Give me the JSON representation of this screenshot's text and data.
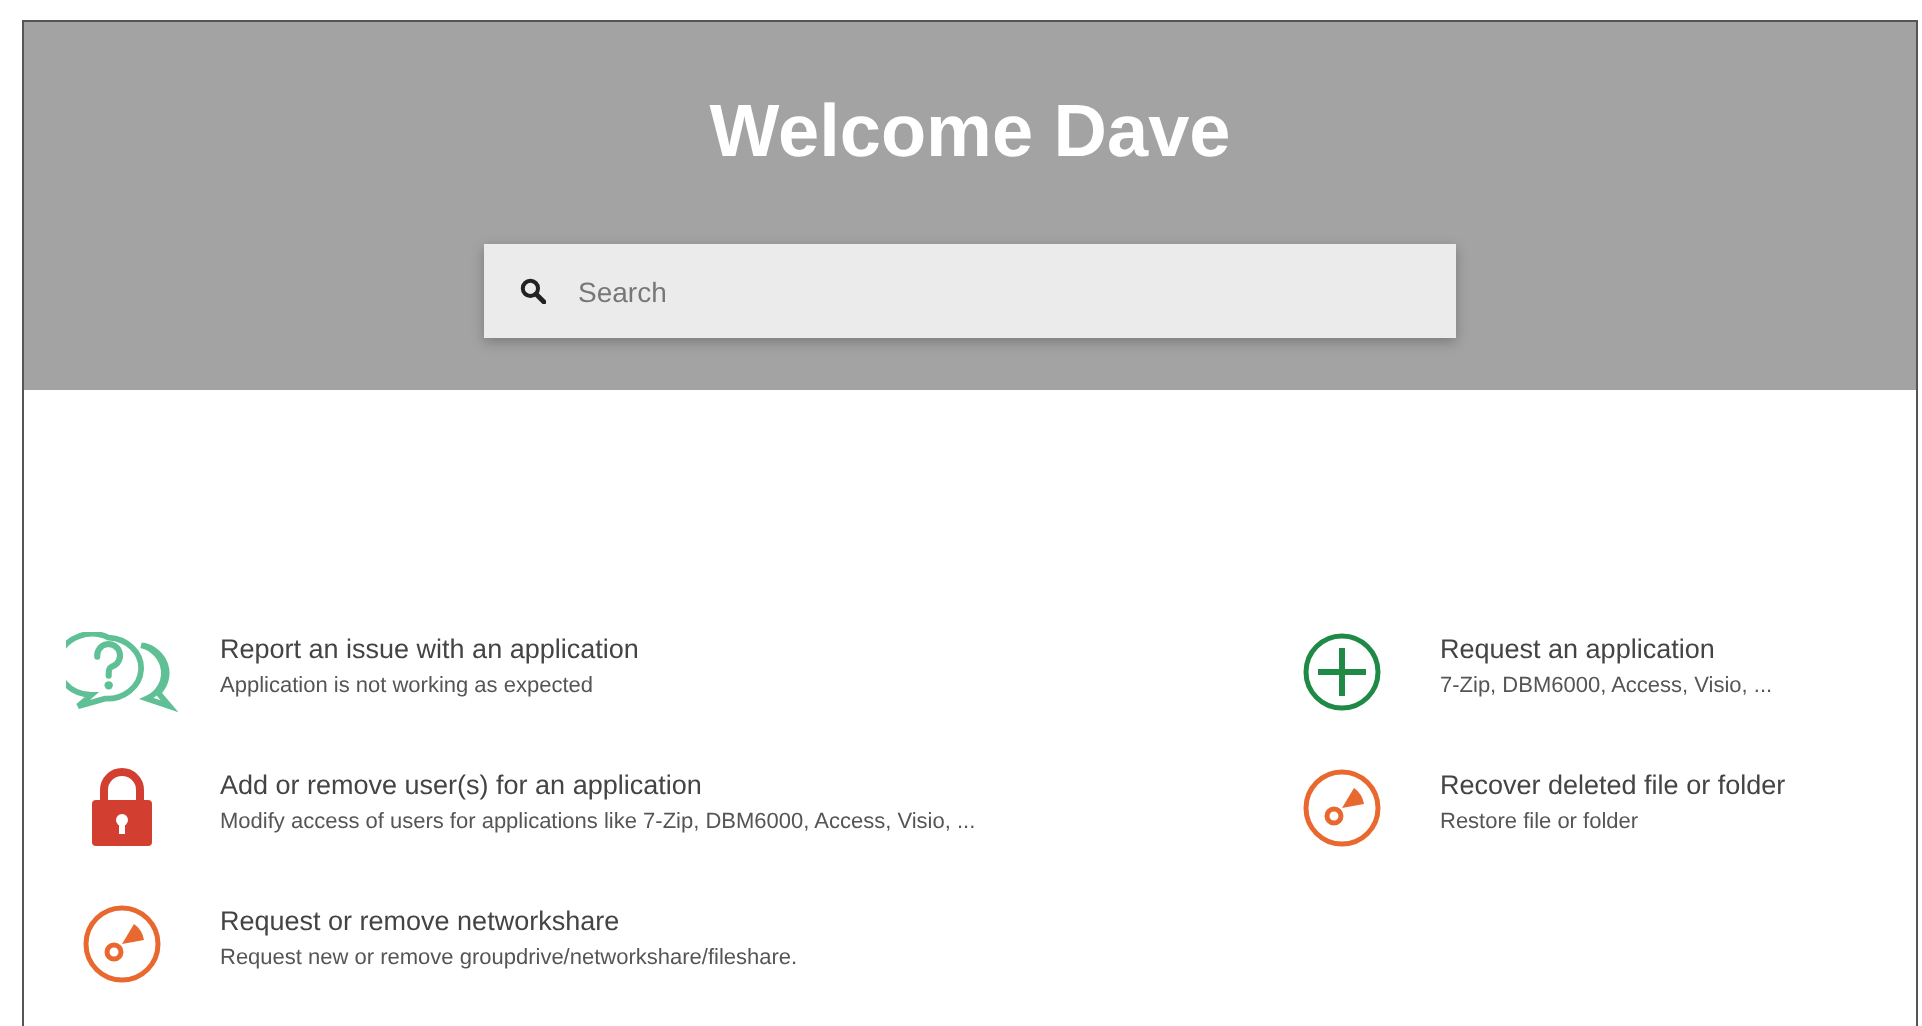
{
  "header": {
    "title": "Welcome Dave"
  },
  "search": {
    "placeholder": "Search"
  },
  "left_services": [
    {
      "title": "Report an issue with an application",
      "description": "Application is not working as expected",
      "kind": "question"
    },
    {
      "title": "Add or remove user(s) for an application",
      "description": "Modify access of users for applications like 7-Zip, DBM6000, Access, Visio, ...",
      "kind": "lock"
    },
    {
      "title": "Request or remove networkshare",
      "description": "Request new or remove groupdrive/networkshare/fileshare.",
      "kind": "disc"
    }
  ],
  "right_services": [
    {
      "title": "Request an application",
      "description": "7-Zip, DBM6000, Access, Visio, ...",
      "kind": "plus"
    },
    {
      "title": "Recover deleted file or folder",
      "description": "Restore file or folder",
      "kind": "disc"
    }
  ]
}
